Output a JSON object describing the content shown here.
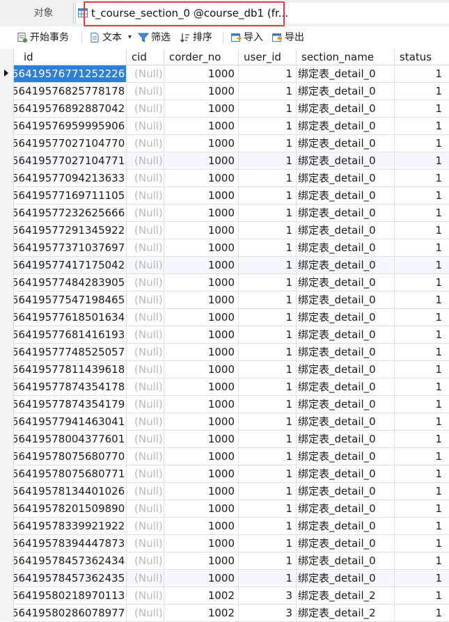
{
  "tabs": {
    "objects_label": "对象",
    "active_label": "t_course_section_0 @course_db1 (fr..."
  },
  "toolbar": {
    "begin_txn": "开始事务",
    "text": "文本",
    "filter": "筛选",
    "sort": "排序",
    "import": "导入",
    "export": "导出"
  },
  "grid": {
    "columns": [
      "id",
      "cid",
      "corder_no",
      "user_id",
      "section_name",
      "status"
    ],
    "rows": [
      [
        "56419576771252226",
        "(Null)",
        "1000",
        "1",
        "绑定表_detail_0",
        "1"
      ],
      [
        "56419576825778178",
        "(Null)",
        "1000",
        "1",
        "绑定表_detail_0",
        "1"
      ],
      [
        "56419576892887042",
        "(Null)",
        "1000",
        "1",
        "绑定表_detail_0",
        "1"
      ],
      [
        "56419576959995906",
        "(Null)",
        "1000",
        "1",
        "绑定表_detail_0",
        "1"
      ],
      [
        "56419577027104770",
        "(Null)",
        "1000",
        "1",
        "绑定表_detail_0",
        "1"
      ],
      [
        "56419577027104771",
        "(Null)",
        "1000",
        "1",
        "绑定表_detail_0",
        "1"
      ],
      [
        "56419577094213633",
        "(Null)",
        "1000",
        "1",
        "绑定表_detail_0",
        "1"
      ],
      [
        "56419577169711105",
        "(Null)",
        "1000",
        "1",
        "绑定表_detail_0",
        "1"
      ],
      [
        "56419577232625666",
        "(Null)",
        "1000",
        "1",
        "绑定表_detail_0",
        "1"
      ],
      [
        "56419577291345922",
        "(Null)",
        "1000",
        "1",
        "绑定表_detail_0",
        "1"
      ],
      [
        "56419577371037697",
        "(Null)",
        "1000",
        "1",
        "绑定表_detail_0",
        "1"
      ],
      [
        "56419577417175042",
        "(Null)",
        "1000",
        "1",
        "绑定表_detail_0",
        "1"
      ],
      [
        "56419577484283905",
        "(Null)",
        "1000",
        "1",
        "绑定表_detail_0",
        "1"
      ],
      [
        "56419577547198465",
        "(Null)",
        "1000",
        "1",
        "绑定表_detail_0",
        "1"
      ],
      [
        "56419577618501634",
        "(Null)",
        "1000",
        "1",
        "绑定表_detail_0",
        "1"
      ],
      [
        "56419577681416193",
        "(Null)",
        "1000",
        "1",
        "绑定表_detail_0",
        "1"
      ],
      [
        "56419577748525057",
        "(Null)",
        "1000",
        "1",
        "绑定表_detail_0",
        "1"
      ],
      [
        "56419577811439618",
        "(Null)",
        "1000",
        "1",
        "绑定表_detail_0",
        "1"
      ],
      [
        "56419577874354178",
        "(Null)",
        "1000",
        "1",
        "绑定表_detail_0",
        "1"
      ],
      [
        "56419577874354179",
        "(Null)",
        "1000",
        "1",
        "绑定表_detail_0",
        "1"
      ],
      [
        "56419577941463041",
        "(Null)",
        "1000",
        "1",
        "绑定表_detail_0",
        "1"
      ],
      [
        "56419578004377601",
        "(Null)",
        "1000",
        "1",
        "绑定表_detail_0",
        "1"
      ],
      [
        "56419578075680770",
        "(Null)",
        "1000",
        "1",
        "绑定表_detail_0",
        "1"
      ],
      [
        "56419578075680771",
        "(Null)",
        "1000",
        "1",
        "绑定表_detail_0",
        "1"
      ],
      [
        "56419578134401026",
        "(Null)",
        "1000",
        "1",
        "绑定表_detail_0",
        "1"
      ],
      [
        "56419578201509890",
        "(Null)",
        "1000",
        "1",
        "绑定表_detail_0",
        "1"
      ],
      [
        "56419578339921922",
        "(Null)",
        "1000",
        "1",
        "绑定表_detail_0",
        "1"
      ],
      [
        "56419578394447873",
        "(Null)",
        "1000",
        "1",
        "绑定表_detail_0",
        "1"
      ],
      [
        "56419578457362434",
        "(Null)",
        "1000",
        "1",
        "绑定表_detail_0",
        "1"
      ],
      [
        "56419578457362435",
        "(Null)",
        "1000",
        "1",
        "绑定表_detail_0",
        "1"
      ],
      [
        "56419580218970113",
        "(Null)",
        "1002",
        "3",
        "绑定表_detail_2",
        "1"
      ],
      [
        "56419580286078977",
        "(Null)",
        "1002",
        "3",
        "绑定表_detail_2",
        "1"
      ]
    ]
  },
  "colors": {
    "selection": "#2f7fd8",
    "highlight_box": "#e23b3b",
    "null_text": "#b8b8b8"
  },
  "icons": {
    "table": "table-icon",
    "begin_txn": "transaction-icon",
    "text": "text-doc-icon",
    "filter": "filter-icon",
    "sort": "sort-icon",
    "import": "import-icon",
    "export": "export-icon"
  }
}
